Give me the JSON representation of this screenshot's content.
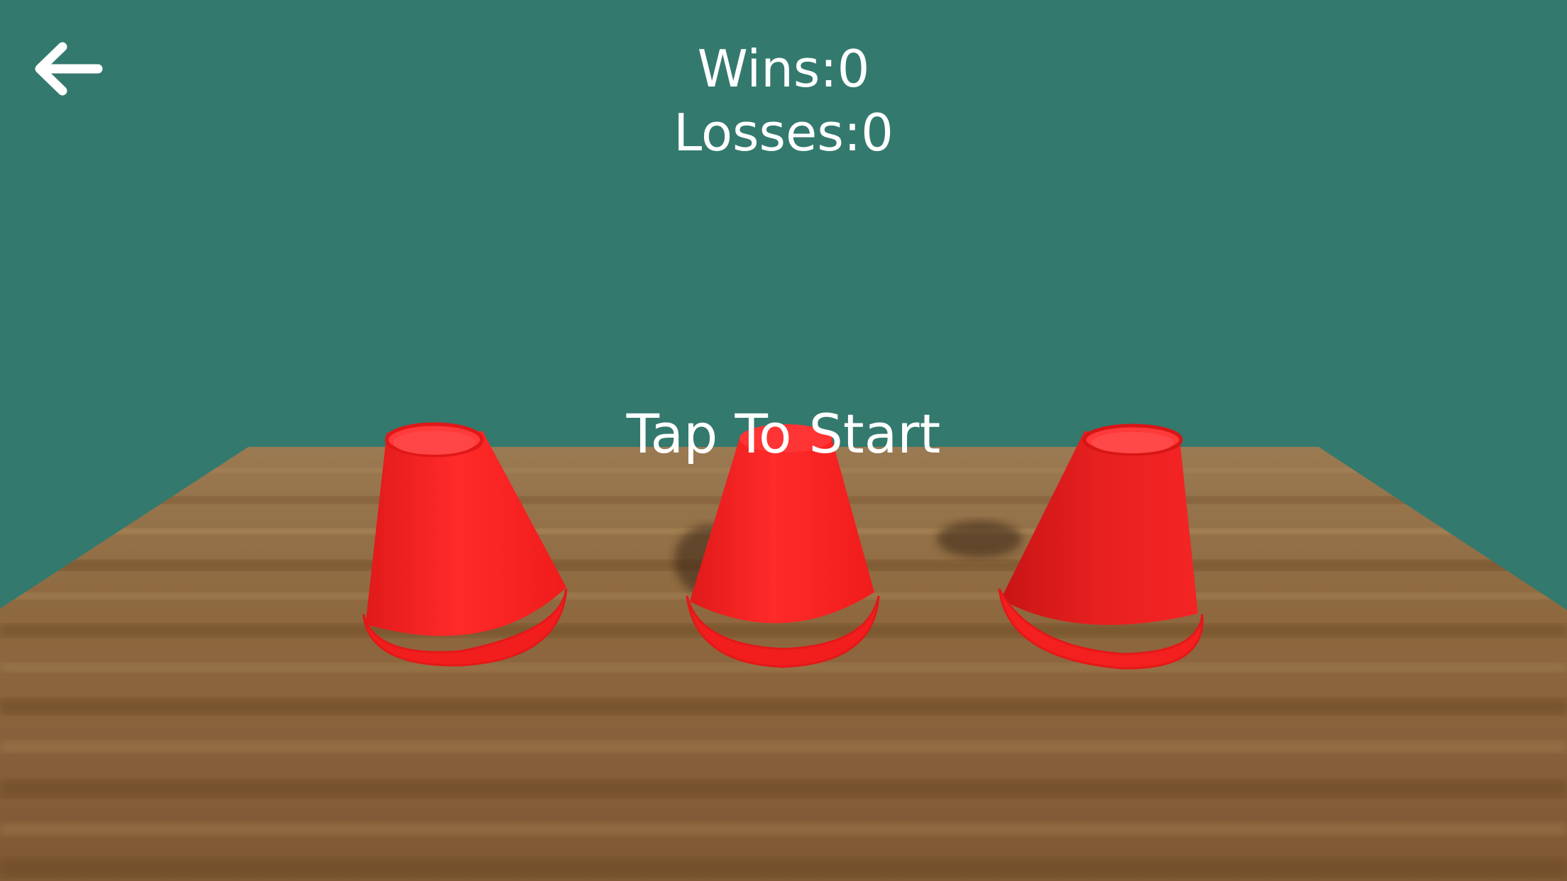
{
  "hud": {
    "wins_label": "Wins:0",
    "losses_label": "Losses:0",
    "start_prompt": "Tap To Start"
  },
  "back_button": {
    "icon": "arrow-left-icon"
  },
  "scene": {
    "background_color": "#33796e",
    "table_color": "#8b6438",
    "cup_color": "#ff2424",
    "cups": [
      {
        "name": "cup-left"
      },
      {
        "name": "cup-middle"
      },
      {
        "name": "cup-right"
      }
    ]
  }
}
